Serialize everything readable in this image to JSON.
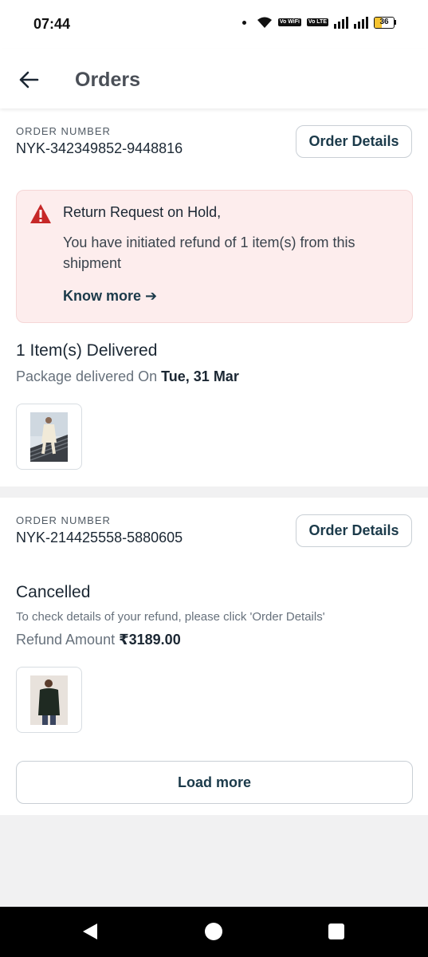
{
  "status_bar": {
    "time": "07:44",
    "wifi_chip": "Vo WiFi",
    "lte_chip": "Vo LTE",
    "battery_level": "36"
  },
  "app_bar": {
    "back_icon": "arrow-left-icon",
    "title": "Orders"
  },
  "orders": [
    {
      "label": "ORDER NUMBER",
      "number": "NYK-342349852-9448816",
      "details_button": "Order Details",
      "alert": {
        "icon": "warning-triangle-icon",
        "title": "Return Request on Hold,",
        "body": "You have initiated refund of 1 item(s) from this shipment",
        "link": "Know more ➔"
      },
      "status_title": "1 Item(s) Delivered",
      "delivery_prefix": "Package delivered On",
      "delivery_date": "Tue, 31 Mar",
      "thumbnail": "product-thumbnail-kurta"
    },
    {
      "label": "ORDER NUMBER",
      "number": "NYK-214425558-5880605",
      "details_button": "Order Details",
      "status_title": "Cancelled",
      "note": "To check details of your refund, please click 'Order Details'",
      "refund_prefix": "Refund Amount",
      "refund_amount": "₹3189.00",
      "thumbnail": "product-thumbnail-jacket"
    }
  ],
  "load_more": "Load more",
  "colors": {
    "accent": "#1b3a4a",
    "alert_bg": "#fdeded",
    "alert_icon": "#c62828",
    "page_bg": "#f1f1f2"
  }
}
